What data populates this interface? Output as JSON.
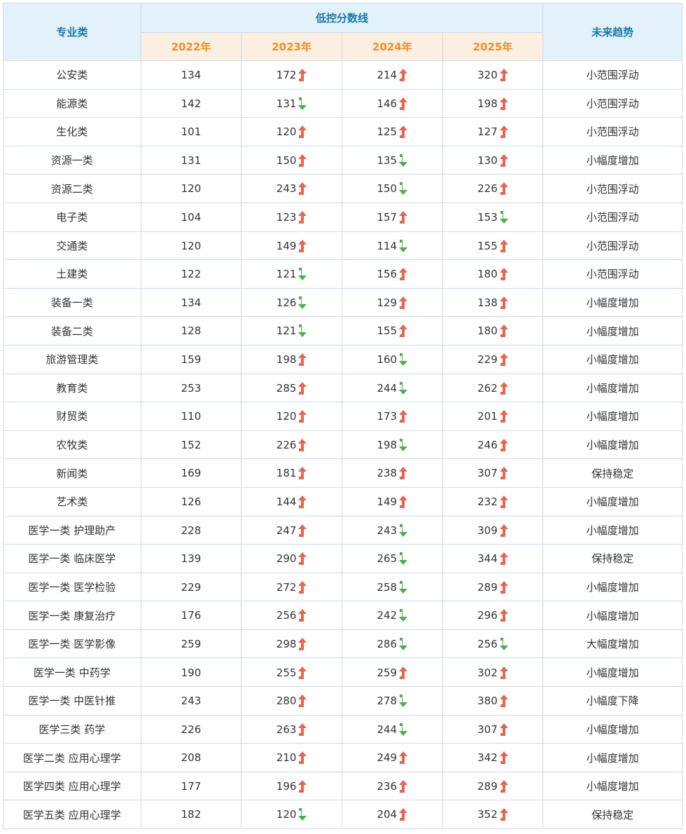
{
  "header": {
    "major": "专业类",
    "group": "低控分数线",
    "years": [
      "2022年",
      "2023年",
      "2024年",
      "2025年"
    ],
    "trend": "未来趋势"
  },
  "colors": {
    "up": "#e46651",
    "down": "#4dae4d",
    "header_text": "#1a7aa8",
    "year_text": "#ec8f2c"
  },
  "rows": [
    {
      "name": "公安类",
      "v": [
        134,
        172,
        214,
        320
      ],
      "dir": [
        null,
        "up",
        "up",
        "up"
      ],
      "trend": "小范围浮动"
    },
    {
      "name": "能源类",
      "v": [
        142,
        131,
        146,
        198
      ],
      "dir": [
        null,
        "down",
        "up",
        "up"
      ],
      "trend": "小范围浮动"
    },
    {
      "name": "生化类",
      "v": [
        101,
        120,
        125,
        127
      ],
      "dir": [
        null,
        "up",
        "up",
        "up"
      ],
      "trend": "小范围浮动"
    },
    {
      "name": "资源一类",
      "v": [
        131,
        150,
        135,
        130
      ],
      "dir": [
        null,
        "up",
        "down",
        "up"
      ],
      "trend": "小幅度增加"
    },
    {
      "name": "资源二类",
      "v": [
        120,
        243,
        150,
        226
      ],
      "dir": [
        null,
        "up",
        "down",
        "up"
      ],
      "trend": "小范围浮动"
    },
    {
      "name": "电子类",
      "v": [
        104,
        123,
        157,
        153
      ],
      "dir": [
        null,
        "up",
        "up",
        "down"
      ],
      "trend": "小范围浮动"
    },
    {
      "name": "交通类",
      "v": [
        120,
        149,
        114,
        155
      ],
      "dir": [
        null,
        "up",
        "down",
        "up"
      ],
      "trend": "小范围浮动"
    },
    {
      "name": "土建类",
      "v": [
        122,
        121,
        156,
        180
      ],
      "dir": [
        null,
        "down",
        "up",
        "up"
      ],
      "trend": "小范围浮动"
    },
    {
      "name": "装备一类",
      "v": [
        134,
        126,
        129,
        138
      ],
      "dir": [
        null,
        "down",
        "up",
        "up"
      ],
      "trend": "小幅度增加"
    },
    {
      "name": "装备二类",
      "v": [
        128,
        121,
        155,
        180
      ],
      "dir": [
        null,
        "down",
        "up",
        "up"
      ],
      "trend": "小幅度增加"
    },
    {
      "name": "旅游管理类",
      "v": [
        159,
        198,
        160,
        229
      ],
      "dir": [
        null,
        "up",
        "down",
        "up"
      ],
      "trend": "小幅度增加"
    },
    {
      "name": "教育类",
      "v": [
        253,
        285,
        244,
        262
      ],
      "dir": [
        null,
        "up",
        "down",
        "up"
      ],
      "trend": "小幅度增加"
    },
    {
      "name": "财贸类",
      "v": [
        110,
        120,
        173,
        201
      ],
      "dir": [
        null,
        "up",
        "up",
        "up"
      ],
      "trend": "小幅度增加"
    },
    {
      "name": "农牧类",
      "v": [
        152,
        226,
        198,
        246
      ],
      "dir": [
        null,
        "up",
        "down",
        "up"
      ],
      "trend": "小幅度增加"
    },
    {
      "name": "新闻类",
      "v": [
        169,
        181,
        238,
        307
      ],
      "dir": [
        null,
        "up",
        "up",
        "up"
      ],
      "trend": "保持稳定"
    },
    {
      "name": "艺术类",
      "v": [
        126,
        144,
        149,
        232
      ],
      "dir": [
        null,
        "up",
        "up",
        "up"
      ],
      "trend": "小幅度增加"
    },
    {
      "name": "医学一类 护理助产",
      "v": [
        228,
        247,
        243,
        309
      ],
      "dir": [
        null,
        "up",
        "down",
        "up"
      ],
      "trend": "小幅度增加"
    },
    {
      "name": "医学一类 临床医学",
      "v": [
        139,
        290,
        265,
        344
      ],
      "dir": [
        null,
        "up",
        "down",
        "up"
      ],
      "trend": "保持稳定"
    },
    {
      "name": "医学一类 医学检验",
      "v": [
        229,
        272,
        258,
        289
      ],
      "dir": [
        null,
        "up",
        "down",
        "up"
      ],
      "trend": "小幅度增加"
    },
    {
      "name": "医学一类 康复治疗",
      "v": [
        176,
        256,
        242,
        296
      ],
      "dir": [
        null,
        "up",
        "down",
        "up"
      ],
      "trend": "小幅度增加"
    },
    {
      "name": "医学一类 医学影像",
      "v": [
        259,
        298,
        286,
        256
      ],
      "dir": [
        null,
        "up",
        "down",
        "down"
      ],
      "trend": "大幅度增加"
    },
    {
      "name": "医学一类 中药学",
      "v": [
        190,
        255,
        259,
        302
      ],
      "dir": [
        null,
        "up",
        "up",
        "up"
      ],
      "trend": "小幅度增加"
    },
    {
      "name": "医学一类 中医针推",
      "v": [
        243,
        280,
        278,
        380
      ],
      "dir": [
        null,
        "up",
        "down",
        "up"
      ],
      "trend": "小幅度下降"
    },
    {
      "name": "医学三类 药学",
      "v": [
        226,
        263,
        244,
        307
      ],
      "dir": [
        null,
        "up",
        "down",
        "up"
      ],
      "trend": "小幅度增加"
    },
    {
      "name": "医学二类 应用心理学",
      "v": [
        208,
        210,
        249,
        342
      ],
      "dir": [
        null,
        "up",
        "up",
        "up"
      ],
      "trend": "小幅度增加"
    },
    {
      "name": "医学四类 应用心理学",
      "v": [
        177,
        196,
        236,
        289
      ],
      "dir": [
        null,
        "up",
        "up",
        "up"
      ],
      "trend": "小幅度增加"
    },
    {
      "name": "医学五类 应用心理学",
      "v": [
        182,
        120,
        204,
        352
      ],
      "dir": [
        null,
        "down",
        "up",
        "up"
      ],
      "trend": "保持稳定"
    }
  ]
}
